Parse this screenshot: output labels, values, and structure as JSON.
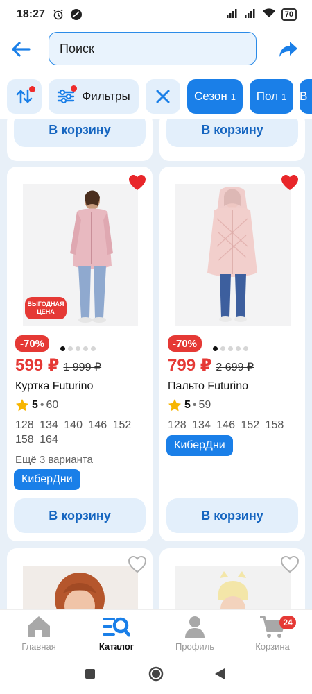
{
  "status_bar": {
    "time": "18:27",
    "battery": "70"
  },
  "search": {
    "placeholder": "Поиск"
  },
  "filters": {
    "filters_label": "Фильтры",
    "chips": [
      {
        "label": "Сезон",
        "count": "1"
      },
      {
        "label": "Пол",
        "count": "1"
      },
      {
        "label": "В"
      }
    ]
  },
  "cart_button_label": "В корзину",
  "products": [
    {
      "promo_badge": "ВЫГОДНАЯ ЦЕНА",
      "discount": "-70%",
      "price": "599 ₽",
      "old_price": "1 999 ₽",
      "title": "Куртка Futurino",
      "rating": "5",
      "reviews": "60",
      "sizes": "128  134  140  146  152  158  164",
      "variants": "Ещё 3 варианта",
      "tag": "КиберДни",
      "favorite": true
    },
    {
      "discount": "-70%",
      "price": "799 ₽",
      "old_price": "2 699 ₽",
      "title": "Пальто Futurino",
      "rating": "5",
      "reviews": "59",
      "sizes": "128  134  146  152  158",
      "tag": "КиберДни",
      "favorite": true
    }
  ],
  "nav": {
    "items": [
      {
        "label": "Главная",
        "icon": "home-icon"
      },
      {
        "label": "Каталог",
        "icon": "catalog-search-icon"
      },
      {
        "label": "Профиль",
        "icon": "profile-icon"
      },
      {
        "label": "Корзина",
        "icon": "cart-icon"
      }
    ],
    "cart_badge": "24"
  },
  "colors": {
    "accent": "#1a7fe8",
    "price_red": "#e53935",
    "chip_bg": "#e3effb",
    "content_bg": "#e8f0f8"
  }
}
